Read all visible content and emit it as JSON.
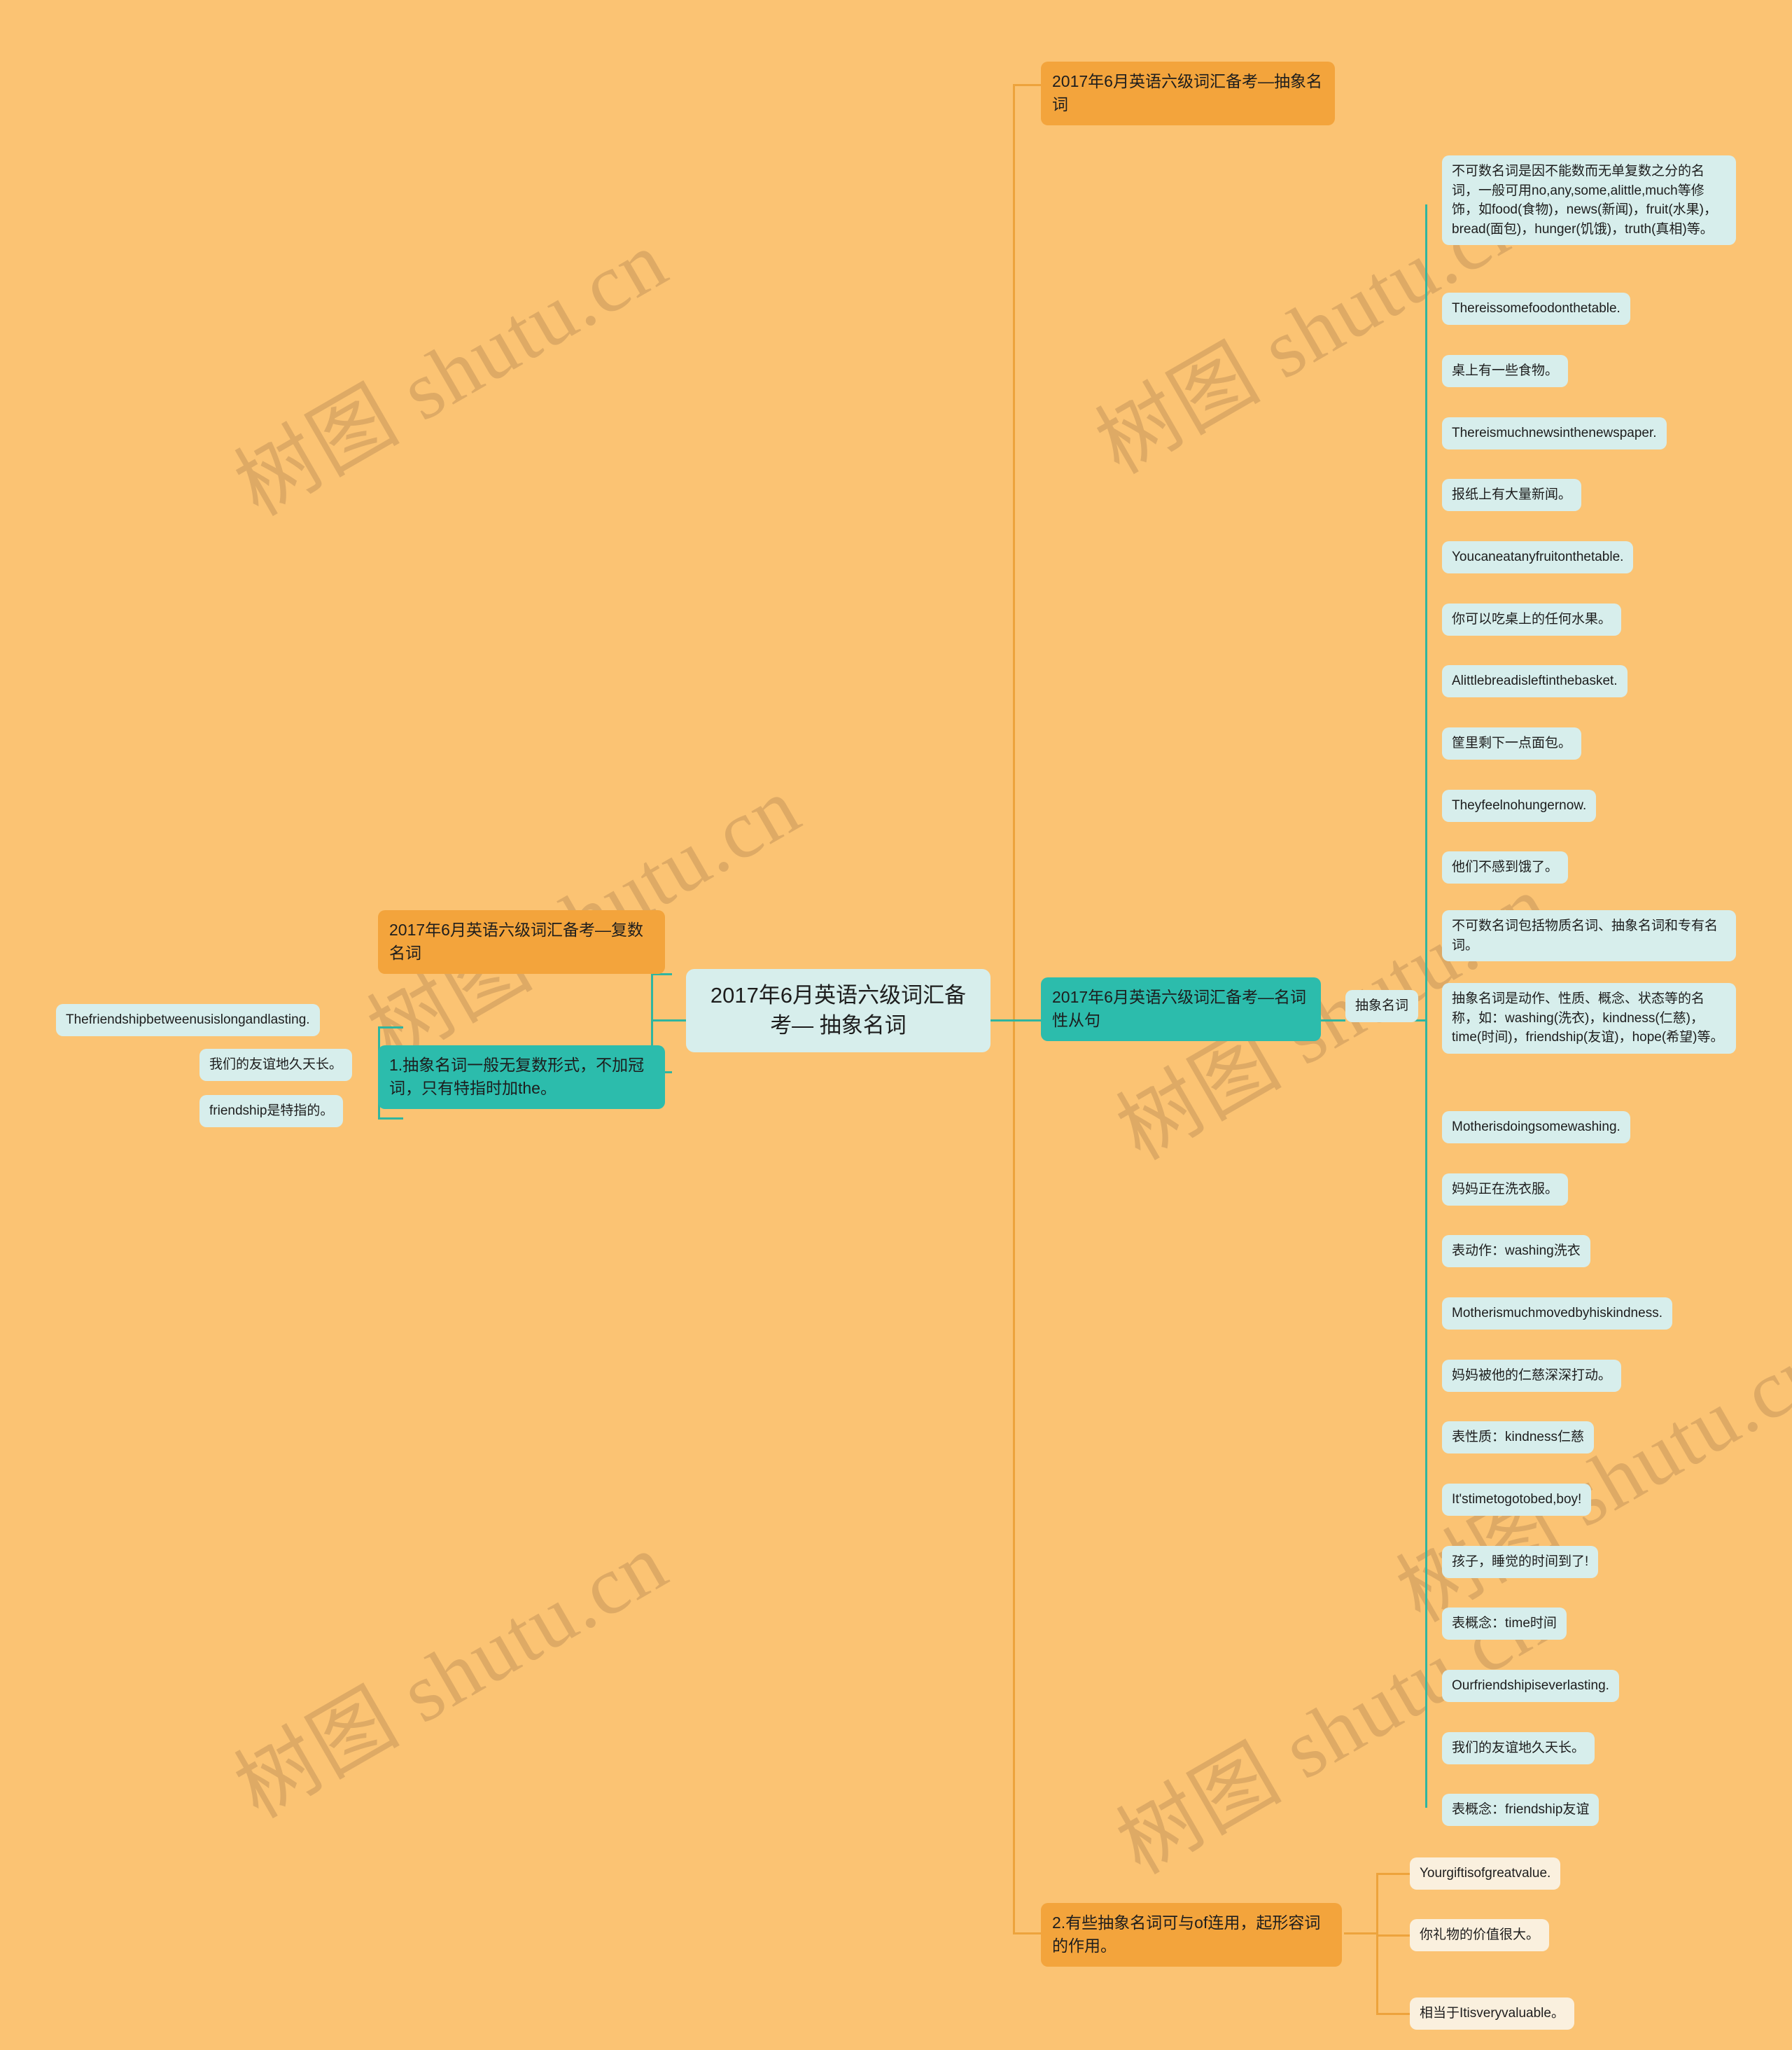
{
  "meta": {
    "background_color": "#fbc373",
    "accent_orange": "#f3a43c",
    "accent_teal": "#2cbcac",
    "leaf_cyan": "#d7eeec",
    "leaf_cream": "#faf0de",
    "edge_teal": "#2fb5a0",
    "edge_orange": "#eda33c"
  },
  "watermark": {
    "text": "树图 shutu.cn"
  },
  "root": {
    "label": "2017年6月英语六级词汇备考— 抽象名词"
  },
  "branches": {
    "top_right": {
      "label": "2017年6月英语六级词汇备考—抽象名词"
    },
    "left": {
      "title": "2017年6月英语六级词汇备考—复数名词",
      "rule": "1.抽象名词一般无复数形式，不加冠词，只有特指时加the。",
      "examples": [
        "Thefriendshipbetweenusislongandlasting.",
        "我们的友谊地久天长。",
        "friendship是特指的。"
      ]
    },
    "right": {
      "title": "2017年6月英语六级词汇备考—名词性从句",
      "child": {
        "label": "抽象名词"
      },
      "items": [
        "不可数名词是因不能数而无单复数之分的名词，一般可用no,any,some,alittle,much等修饰，如food(食物)，news(新闻)，fruit(水果)，bread(面包)，hunger(饥饿)，truth(真相)等。",
        "Thereissomefoodonthetable.",
        "桌上有一些食物。",
        "Thereismuchnewsinthenewspaper.",
        "报纸上有大量新闻。",
        "Youcaneatanyfruitonthetable.",
        "你可以吃桌上的任何水果。",
        "Alittlebreadisleftinthebasket.",
        "筐里剩下一点面包。",
        "Theyfeelnohungernow.",
        "他们不感到饿了。",
        "不可数名词包括物质名词、抽象名词和专有名词。",
        "抽象名词是动作、性质、概念、状态等的名称，如：washing(洗衣)，kindness(仁慈)，time(时间)，friendship(友谊)，hope(希望)等。",
        "Motherisdoingsomewashing.",
        "妈妈正在洗衣服。",
        "表动作：washing洗衣",
        "Motherismuchmovedbyhiskindness.",
        "妈妈被他的仁慈深深打动。",
        "表性质：kindness仁慈",
        "It'stimetogotobed,boy!",
        "孩子，睡觉的时间到了!",
        "表概念：time时间",
        "Ourfriendshipiseverlasting.",
        "我们的友谊地久天长。",
        "表概念：friendship友谊"
      ]
    },
    "bottom_right": {
      "title": "2.有些抽象名词可与of连用，起形容词的作用。",
      "examples": [
        "Yourgiftisofgreatvalue.",
        "你礼物的价值很大。",
        "相当于Itisveryvaluable。"
      ]
    }
  }
}
